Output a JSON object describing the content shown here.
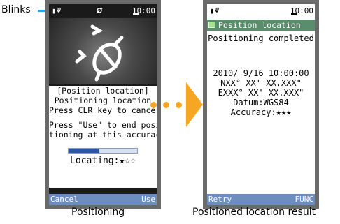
{
  "callout": {
    "label": "Blinks",
    "target_icon": "gps-positioning-icon"
  },
  "left_screen": {
    "status": {
      "clock": "10:00",
      "signal_icon": "signal-antenna-icon",
      "battery_icon": "battery-icon"
    },
    "message_lines": [
      "[Position location]",
      "Positioning location",
      "Press CLR key to cancel",
      "Press \"Use\" to end posi-",
      "tioning at this accuracy"
    ],
    "progress": 0.45,
    "locating_label": "Locating:",
    "locating_stars": "★☆☆",
    "accuracy_level": 1,
    "softkeys": {
      "left": "Cancel",
      "right": "Use"
    },
    "caption": "Positioning"
  },
  "right_screen": {
    "status": {
      "clock": "10:00"
    },
    "title": "Position location",
    "completed": "Positioning completed",
    "result_lines": [
      "2010/ 9/16 10:00:00",
      "NXX° XX' XX.XXX\"",
      "EXXX° XX' XX.XXX\"",
      "Datum:WGS84",
      "Accuracy:★★★"
    ],
    "softkeys": {
      "left": "Retry",
      "right": "FUNC"
    },
    "caption": "Positioned location result"
  },
  "colors": {
    "accent_cyan": "#2aa6de",
    "arrow_orange": "#f5a623",
    "softkey_blue": "#6d8dbf",
    "title_green": "#5a8d6c"
  }
}
